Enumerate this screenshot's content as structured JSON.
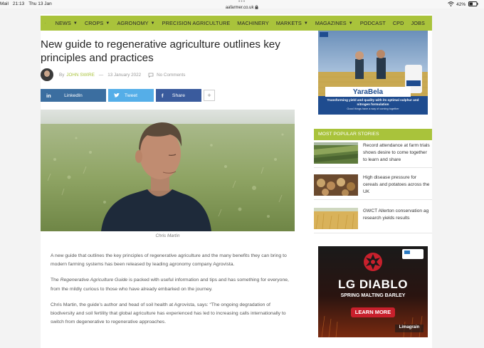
{
  "statusbar": {
    "carrier": "Mail",
    "time": "21:13",
    "date": "Thu 13 Jan",
    "url": "aafarmer.co.uk",
    "battery": "42%"
  },
  "nav": {
    "items": [
      {
        "label": "News"
      },
      {
        "label": "Crops"
      },
      {
        "label": "Agronomy"
      },
      {
        "label": "Precision Agriculture"
      },
      {
        "label": "Machinery"
      },
      {
        "label": "Markets"
      },
      {
        "label": "Magazines"
      },
      {
        "label": "Podcast"
      },
      {
        "label": "CPD"
      },
      {
        "label": "Jobs"
      }
    ]
  },
  "article": {
    "headline": "New guide to regenerative agriculture outlines key principles and practices",
    "by": "By",
    "author": "JOHN SWIRE",
    "date": "13 January 2022",
    "comments": "No Comments",
    "share": {
      "linkedin": "LinkedIn",
      "twitter": "Tweet",
      "facebook": "Share",
      "more": "+"
    },
    "caption": "Chris Martin",
    "paragraphs": {
      "p1": "A new guide that outlines the key principles of regenerative agriculture and the many benefits they can bring to modern farming systems has been released by leading agronomy company Agrovista.",
      "p2_prefix": "The ",
      "p2_title": "Regenerative Agriculture Guide",
      "p2_rest": " is packed with useful information and tips and has something for everyone, from the mildly curious to those who have already embarked on the journey.",
      "p3": "Chris Martin, the guide’s author and head of soil health at Agrovista, says: “The ongoing degradation of biodiversity and soil fertility that global agriculture has experienced has led to increasing calls internationally to switch from degenerative to regenerative approaches."
    }
  },
  "sidebar": {
    "ad1": {
      "brand": "YaraBela",
      "tagline": "Transforming yield and quality with its optimal sulphur and nitrogen formulation",
      "sub": "Good things have a way of coming together"
    },
    "popular_heading": "Most Popular Stories",
    "stories": [
      {
        "title": "Record attendance at farm trials shows desire to come together to learn and share"
      },
      {
        "title": "High disease pressure for cereals and potatoes across the UK"
      },
      {
        "title": "GWCT Allerton conservation ag research yields results"
      }
    ],
    "ad2": {
      "brand": "LG DIABLO",
      "sub": "SPRING MALTING BARLEY",
      "cta": "LEARN MORE",
      "company": "Limagrain"
    }
  },
  "colors": {
    "accent": "#a9c33b",
    "linkedin": "#3b6ea0",
    "twitter": "#55aee8",
    "facebook": "#3a5b9d",
    "lg_red": "#c8202c"
  }
}
